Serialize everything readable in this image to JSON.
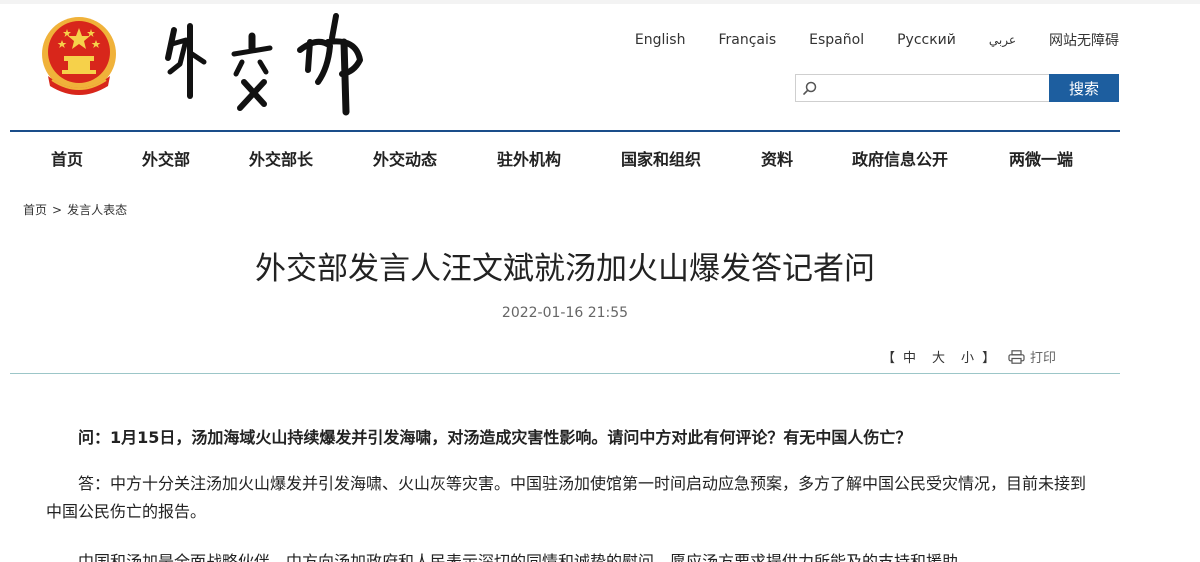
{
  "header": {
    "emblem_name": "national-emblem",
    "logo_text": "外交部",
    "languages": [
      "English",
      "Français",
      "Español",
      "Русский",
      "عربي",
      "网站无障碍"
    ],
    "search": {
      "placeholder": "",
      "button_label": "搜索"
    }
  },
  "nav": {
    "items": [
      "首页",
      "外交部",
      "外交部长",
      "外交动态",
      "驻外机构",
      "国家和组织",
      "资料",
      "政府信息公开",
      "两微一端"
    ]
  },
  "breadcrumb": {
    "home": "首页",
    "separator": ">",
    "current": "发言人表态"
  },
  "article": {
    "title": "外交部发言人汪文斌就汤加火山爆发答记者问",
    "date": "2022-01-16 21:55",
    "font_size": {
      "open": "【",
      "large": "中",
      "medium": "大",
      "small": "小",
      "close": "】"
    },
    "print_label": "打印",
    "question": "问：1月15日，汤加海域火山持续爆发并引发海啸，对汤造成灾害性影响。请问中方对此有何评论？有无中国人伤亡？",
    "answer_1": "答：中方十分关注汤加火山爆发并引发海啸、火山灰等灾害。中国驻汤加使馆第一时间启动应急预案，多方了解中国公民受灾情况，目前未接到中国公民伤亡的报告。",
    "answer_2": "中国和汤加是全面战略伙伴，中方向汤加政府和人民表示深切的同情和诚挚的慰问，愿应汤方要求提供力所能及的支持和援助。"
  },
  "colors": {
    "nav_line": "#1a4e8a",
    "search_button": "#1d5e9f",
    "emblem_red": "#d8261b",
    "emblem_gold": "#f0b23a",
    "divider": "#9cc6c8"
  }
}
